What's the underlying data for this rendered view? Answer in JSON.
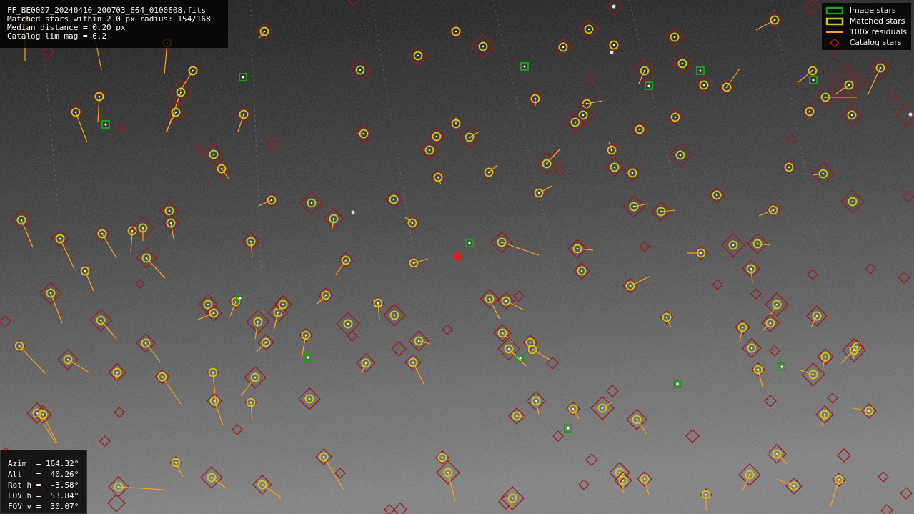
{
  "header_lines": [
    "FF_BE0007_20240410_200703_664_0100608.fits",
    "Matched stars within 2.0 px radius: 154/168",
    "Median distance = 0.20 px",
    "Catalog lim mag = 6.2"
  ],
  "legend": [
    {
      "kind": "box",
      "color": "#1f9a1f",
      "label": "Image stars"
    },
    {
      "kind": "box",
      "color": "#c8c81e",
      "label": "Matched stars"
    },
    {
      "kind": "line",
      "color": "#ffa020",
      "label": "100x residuals"
    },
    {
      "kind": "diamond",
      "color": "#b01a1a",
      "label": "Catalog stars"
    }
  ],
  "pointing_lines": [
    "Azim  = 164.32°",
    "Alt   =  40.26°",
    "Rot h =  -3.58°",
    "FOV h =  53.84°",
    "FOV v =  30.07°"
  ]
}
